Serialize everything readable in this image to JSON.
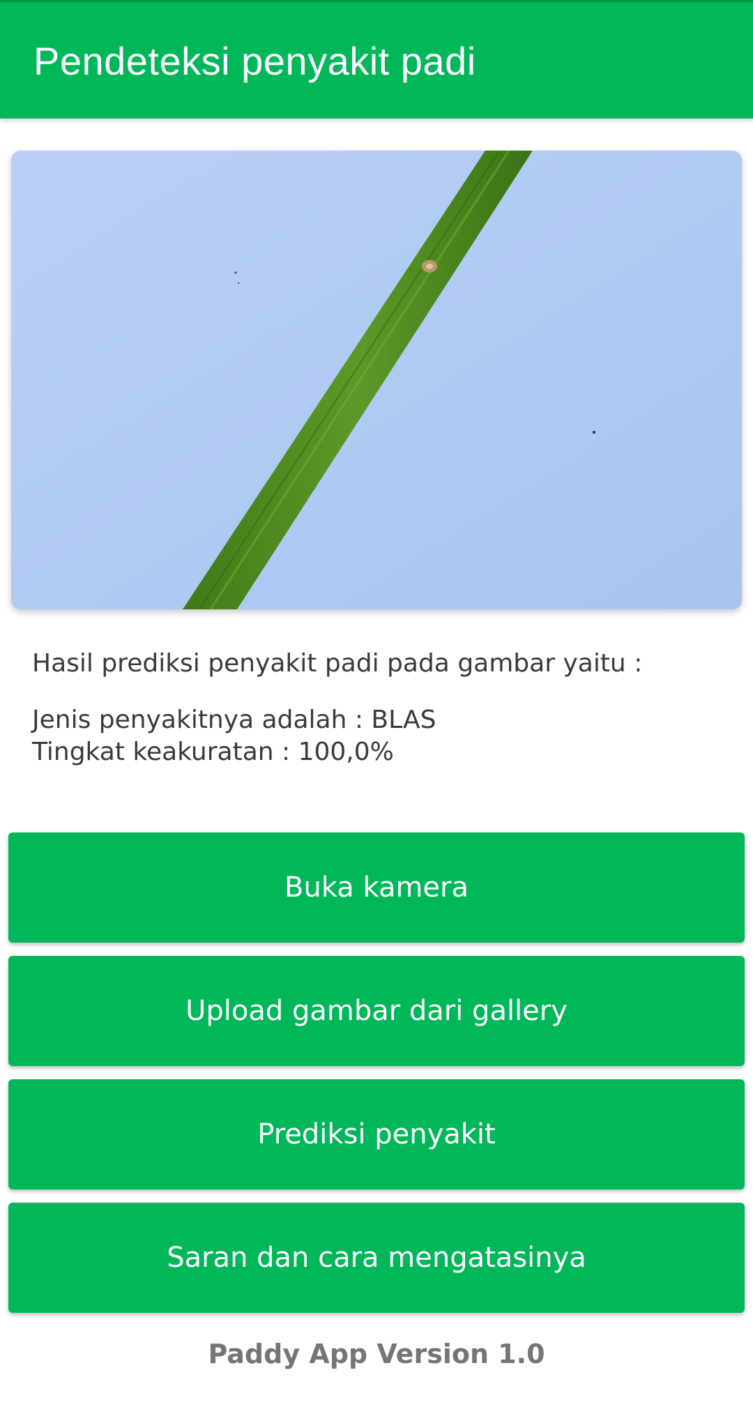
{
  "app_bar": {
    "title": "Pendeteksi penyakit padi",
    "color": "#00b75a"
  },
  "image": {
    "icon": "rice-leaf-photo",
    "background_color": "#b7cff5",
    "leaf_color": "#4f8a1f"
  },
  "result": {
    "heading": "Hasil prediksi penyakit padi pada gambar yaitu :",
    "disease_line": "Jenis penyakitnya adalah : BLAS",
    "accuracy_line": "Tingkat keakuratan : 100,0%"
  },
  "buttons": {
    "open_camera": "Buka kamera",
    "upload_gallery": "Upload gambar dari gallery",
    "predict": "Prediksi penyakit",
    "advice": "Saran dan cara mengatasinya"
  },
  "footer": {
    "version": "Paddy App Version 1.0"
  }
}
